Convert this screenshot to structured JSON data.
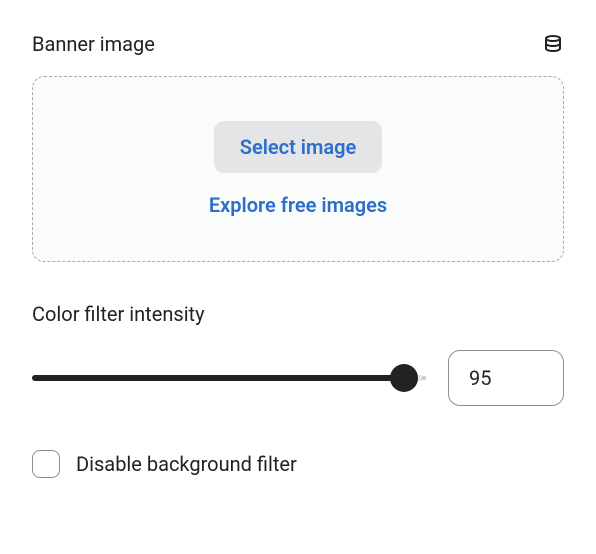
{
  "banner": {
    "label": "Banner image",
    "select_button": "Select image",
    "explore_link": "Explore free images"
  },
  "intensity": {
    "label": "Color filter intensity",
    "value": "95",
    "min": 0,
    "max": 100
  },
  "disable_filter": {
    "label": "Disable background filter",
    "checked": false
  }
}
